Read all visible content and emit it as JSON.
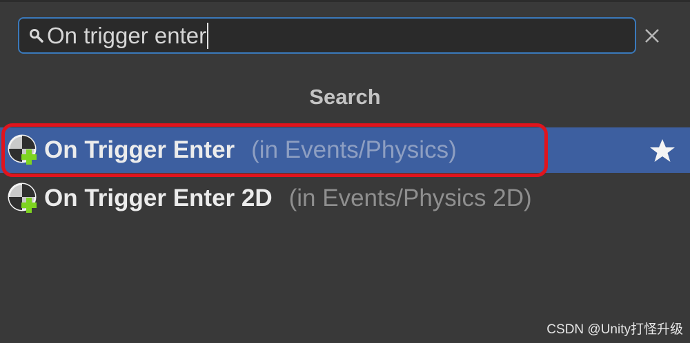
{
  "search": {
    "value": "On trigger enter",
    "icon": "search-icon"
  },
  "clear_icon": "close-icon",
  "section": {
    "title": "Search"
  },
  "results": [
    {
      "label": "On Trigger Enter",
      "path": "(in Events/Physics)",
      "icon": "event-node-add-icon",
      "selected": true,
      "favorite_icon": "star-icon"
    },
    {
      "label": "On Trigger Enter 2D",
      "path": "(in Events/Physics 2D)",
      "icon": "event-node-add-icon",
      "selected": false
    }
  ],
  "watermark": "CSDN @Unity打怪升级",
  "colors": {
    "panel_background": "#393939",
    "search_border": "#3a79bb",
    "selected_row": "#3d5fa0",
    "highlight_ring": "#e0141d",
    "plus_green": "#7ed321"
  }
}
